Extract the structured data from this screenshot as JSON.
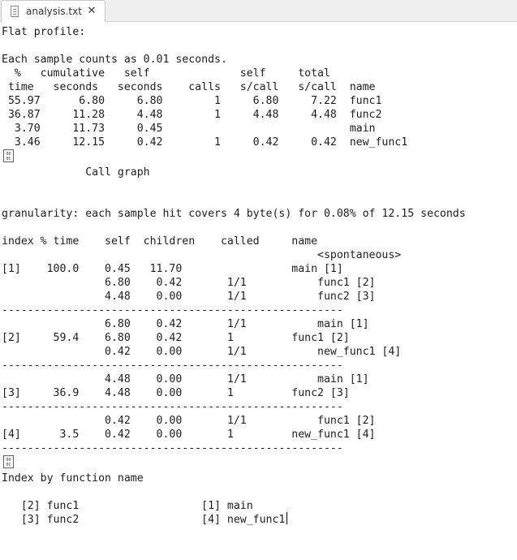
{
  "tab": {
    "title": "analysis.txt",
    "close": "✕"
  },
  "icons": {
    "file_icon": "text-file-icon",
    "close_icon": "close-icon",
    "control_char": "form-feed-glyph"
  },
  "control_char": {
    "hex_top": "00",
    "hex_bottom": "0C"
  },
  "lines": [
    "Flat profile:",
    "",
    "Each sample counts as 0.01 seconds.",
    "  %   cumulative   self              self     total",
    " time   seconds   seconds    calls   s/call   s/call  name",
    " 55.97      6.80     6.80        1     6.80     7.22  func1",
    " 36.87     11.28     4.48        1     4.48     4.48  func2",
    "  3.70     11.73     0.45                             main",
    "  3.46     12.15     0.42        1     0.42     0.42  new_func1",
    "",
    "             Call graph",
    "",
    "",
    "granularity: each sample hit covers 4 byte(s) for 0.08% of 12.15 seconds",
    "",
    "index % time    self  children    called     name",
    "                                                 <spontaneous>",
    "[1]    100.0    0.45   11.70                 main [1]",
    "                6.80    0.42       1/1           func1 [2]",
    "                4.48    0.00       1/1           func2 [3]",
    "-----------------------------------------------------",
    "                6.80    0.42       1/1           main [1]",
    "[2]     59.4    6.80    0.42       1         func1 [2]",
    "                0.42    0.00       1/1           new_func1 [4]",
    "-----------------------------------------------------",
    "                4.48    0.00       1/1           main [1]",
    "[3]     36.9    4.48    0.00       1         func2 [3]",
    "-----------------------------------------------------",
    "                0.42    0.00       1/1           func1 [2]",
    "[4]      3.5    0.42    0.00       1         new_func1 [4]",
    "-----------------------------------------------------",
    "",
    "Index by function name",
    "",
    "   [2] func1                   [1] main",
    "   [3] func2                   [4] new_func1"
  ]
}
